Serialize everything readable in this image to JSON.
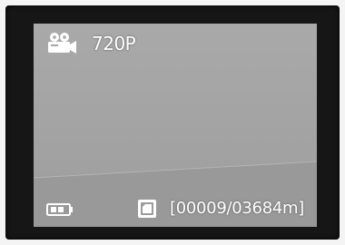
{
  "osd": {
    "mode_icon": "video-camera-icon",
    "resolution": "720P",
    "battery_icon": "battery-icon",
    "storage_icon": "sd-card-icon",
    "recording_counter": "[00009/03684m]"
  },
  "colors": {
    "bezel": "#161616",
    "screen": "#a5a5a5",
    "osd_text": "#ffffff"
  }
}
